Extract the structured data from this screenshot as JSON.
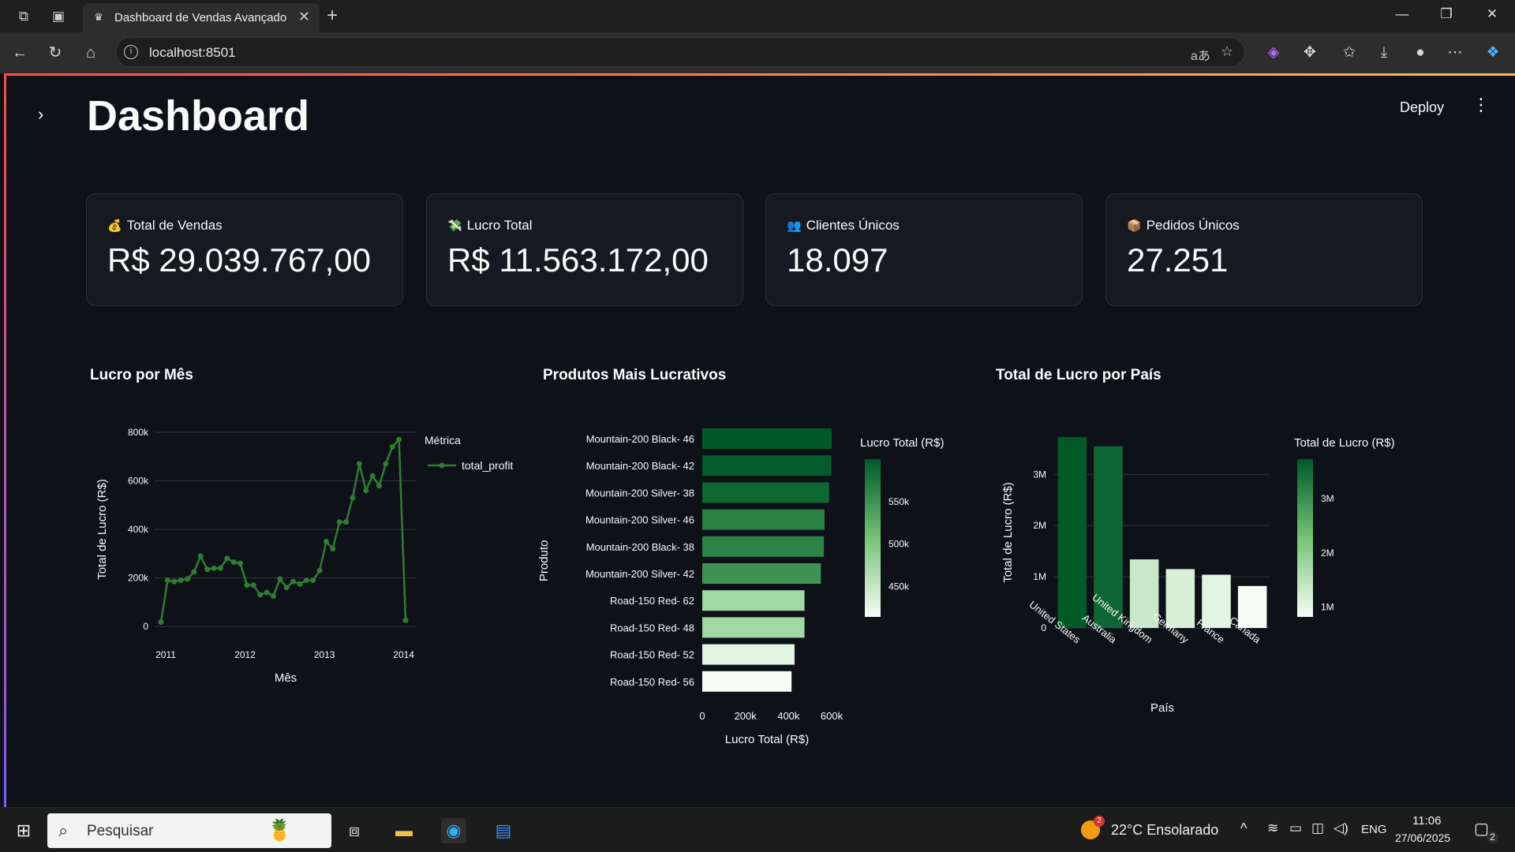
{
  "browser": {
    "tab_title": "Dashboard de Vendas Avançado",
    "url": "localhost:8501"
  },
  "app": {
    "title": "Dashboard",
    "deploy_label": "Deploy"
  },
  "metrics": [
    {
      "icon": "money-bag-icon",
      "emoji": "💰",
      "label": "Total de Vendas",
      "value": "R$ 29.039.767,00"
    },
    {
      "icon": "money-wings-icon",
      "emoji": "💸",
      "label": "Lucro Total",
      "value": "R$ 11.563.172,00"
    },
    {
      "icon": "people-icon",
      "emoji": "👥",
      "label": "Clientes Únicos",
      "value": "18.097"
    },
    {
      "icon": "package-icon",
      "emoji": "📦",
      "label": "Pedidos Únicos",
      "value": "27.251"
    }
  ],
  "chart_titles": {
    "monthly": "Lucro por Mês",
    "products": "Produtos Mais Lucrativos",
    "countries": "Total de Lucro por País"
  },
  "chart_data": [
    {
      "type": "line",
      "title": "Lucro por Mês",
      "xlabel": "Mês",
      "ylabel": "Total de Lucro (R$)",
      "legend_title": "Métrica",
      "series_name": "total_profit",
      "color": "#2e7d32",
      "x_ticks": [
        "2011",
        "2012",
        "2013",
        "2014"
      ],
      "y_ticks": [
        "0",
        "200k",
        "400k",
        "600k",
        "800k"
      ],
      "ylim": [
        0,
        800000
      ],
      "x_start": "2011-01",
      "values": [
        18000,
        190000,
        185000,
        190000,
        195000,
        225000,
        290000,
        235000,
        240000,
        240000,
        280000,
        265000,
        260000,
        170000,
        170000,
        130000,
        140000,
        125000,
        195000,
        160000,
        185000,
        175000,
        190000,
        190000,
        230000,
        350000,
        320000,
        430000,
        430000,
        530000,
        670000,
        560000,
        620000,
        580000,
        670000,
        740000,
        770000,
        25000
      ],
      "legend": "top-right"
    },
    {
      "type": "bar",
      "orientation": "horizontal",
      "title": "Produtos Mais Lucrativos",
      "xlabel": "Lucro Total (R$)",
      "ylabel": "Produto",
      "categories": [
        "Mountain-200 Black- 46",
        "Mountain-200 Black- 42",
        "Mountain-200 Silver- 38",
        "Mountain-200 Silver- 46",
        "Mountain-200 Black- 38",
        "Mountain-200 Silver- 42",
        "Road-150 Red- 62",
        "Road-150 Red- 48",
        "Road-150 Red- 52",
        "Road-150 Red- 56"
      ],
      "values": [
        600000,
        598000,
        588000,
        567000,
        564000,
        550000,
        474000,
        474000,
        428000,
        414000
      ],
      "x_ticks": [
        "0",
        "200k",
        "400k",
        "600k"
      ],
      "xlim": [
        0,
        600000
      ],
      "colorbar_title": "Lucro Total (R$)",
      "colorbar_ticks": [
        "550k",
        "500k",
        "450k"
      ],
      "color_range": [
        414000,
        600000
      ]
    },
    {
      "type": "bar",
      "orientation": "vertical",
      "title": "Total de Lucro por País",
      "xlabel": "País",
      "ylabel": "Total de Lucro (R$)",
      "categories": [
        "United States",
        "Australia",
        "United Kingdom",
        "Germany",
        "France",
        "Canada"
      ],
      "values": [
        3730000,
        3550000,
        1340000,
        1150000,
        1040000,
        820000
      ],
      "y_ticks": [
        "0",
        "1M",
        "2M",
        "3M"
      ],
      "ylim": [
        0,
        3730000
      ],
      "colorbar_title": "Total de Lucro (R$)",
      "colorbar_ticks": [
        "3M",
        "2M",
        "1M"
      ],
      "color_range": [
        820000,
        3730000
      ]
    }
  ],
  "taskbar": {
    "search_placeholder": "Pesquisar",
    "weather": "22°C  Ensolarado",
    "weather_badge": "2",
    "language": "ENG",
    "time": "11:06",
    "date": "27/06/2025",
    "notifications": "2"
  }
}
